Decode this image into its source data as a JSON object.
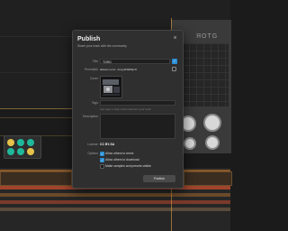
{
  "background": {
    "instrument_title": "ЯOTG"
  },
  "dialog": {
    "title": "Publish",
    "subtitle": "Share your track with the community",
    "close_glyph": "×",
    "fields": {
      "title_label": "Title",
      "title_value": "TORG",
      "permalink_label": "Permalink",
      "permalink_value": "ableton.com/.../torg-9h9k8bp3f",
      "cover_label": "Cover",
      "tags_label": "Tags",
      "tags_placeholder": "",
      "tags_hint": "Use tags to help others discover your track",
      "description_label": "Description",
      "license_label": "License",
      "license_value": "CC BY-SA",
      "options_label": "Options"
    },
    "options": [
      {
        "label": "Allow others to remix",
        "checked": true
      },
      {
        "label": "Allow others to download",
        "checked": true
      },
      {
        "label": "Make samples and presets visible",
        "checked": false
      }
    ],
    "publish_label": "Publish",
    "colors": {
      "checkbox_on": "#2a8fd6",
      "dialog_bg": "#2f2f2f"
    }
  }
}
